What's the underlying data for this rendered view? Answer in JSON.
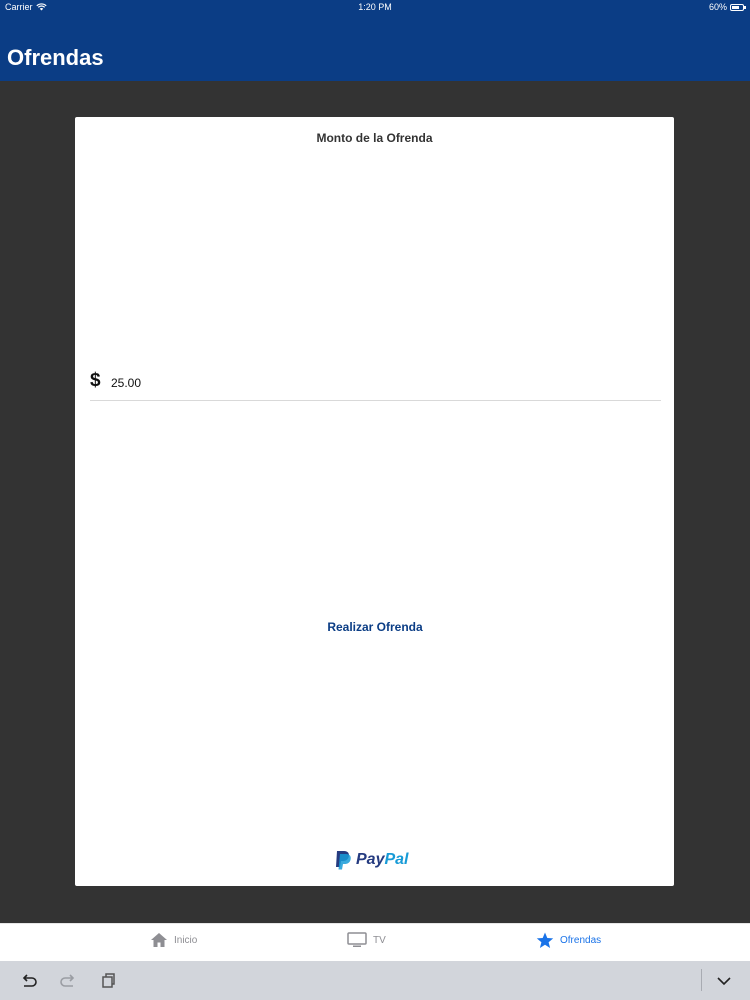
{
  "status_bar": {
    "carrier": "Carrier",
    "time": "1:20 PM",
    "battery": "60%"
  },
  "nav": {
    "title": "Ofrendas"
  },
  "offering_form": {
    "heading": "Monto de la Ofrenda",
    "currency_symbol": "$",
    "amount_value": "25.00",
    "submit_label": "Realizar Ofrenda"
  },
  "paypal": {
    "pay": "Pay",
    "pal": "Pal"
  },
  "tabs": [
    {
      "label": "Inicio",
      "icon": "home-icon",
      "active": false
    },
    {
      "label": "TV",
      "icon": "tv-icon",
      "active": false
    },
    {
      "label": "Ofrendas",
      "icon": "star-icon",
      "active": true
    }
  ],
  "keyboard_toolbar": {
    "icons": [
      "undo-icon",
      "redo-icon",
      "clipboard-icon",
      "chevron-down-icon"
    ]
  },
  "colors": {
    "brand_blue": "#0b3d85",
    "active_tab": "#1a73e8",
    "background": "#333333"
  }
}
